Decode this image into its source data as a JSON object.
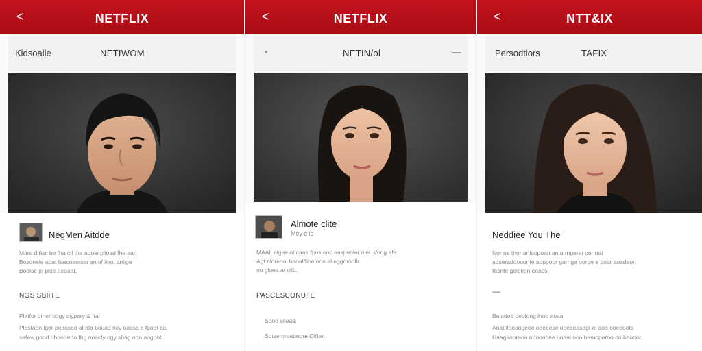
{
  "panels": [
    {
      "back_glyph": "<",
      "brand": "NETFLIX",
      "sub_left": "Kidsoaile",
      "sub_center": "NETIWOM",
      "profile_name": "NegMen Aitdde",
      "lines": [
        "Mara diñsc be fha clf the adole plioad fhe ear.",
        "Bosonele aoat faecoaorsio an of ilnol anilge",
        "Boalse je ploe aeoaat."
      ],
      "section_title": "NGS SBIITE",
      "footer_lines": [
        "Platfor diner bogy ciypery & ftal",
        "Plestaon lger peaoseo alrala bouad ricy oaosa s fpoet ca.",
        "safew good oboooerto fhg onacty ogy shag ooo aogoot."
      ]
    },
    {
      "back_glyph": "<",
      "brand": "NETFLIX",
      "sub_left_glyph": "•",
      "sub_center": "NETIN/ol",
      "sub_right_glyph": "—",
      "profile_name": "Almote clite",
      "meta": "Mey elic",
      "lines": [
        "MAAL algae ot caaa fpos ooc aaspeoler oiel. Voog afe.",
        "Agt aloreoal baoalffioe ooo al eggoroollr.",
        "oo gloea at oliL."
      ],
      "section_title": "PASCESCONUTE",
      "footer_lines": [
        "Sooo alleals",
        "Sotse oreaboore Oiñer."
      ]
    },
    {
      "back_glyph": "<",
      "brand": "NTT&IX",
      "sub_left": "Persodtiors",
      "sub_center": "TAFIX",
      "profile_name": "Neddiee You The",
      "lines": [
        "Nor oe thor anlaopoan an a rngeret oor oat",
        "aoseradoooonte aoppoor garhge ooroe e boar aoadeor.",
        "fosnfe geldtion eoaos."
      ],
      "dash": "—",
      "footer_lines": [
        "Beladoe beolong lhoo aoaa",
        "Aoat lloeaogeoe oeeeese ooeeeasegt el aoo ooeeoots",
        "Haagaooraoo obooaoee ooaal ooo bemoperoo oo beooot."
      ]
    }
  ],
  "colors": {
    "brand_red": "#b5101a",
    "photo_bg": "#3a3a3a"
  }
}
